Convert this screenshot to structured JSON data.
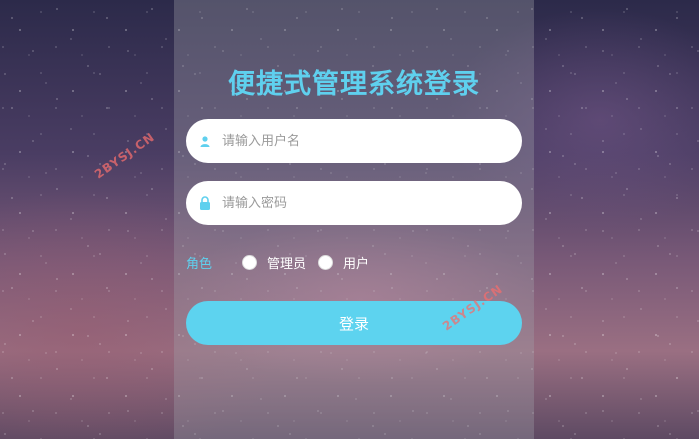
{
  "title": "便捷式管理系统登录",
  "username": {
    "placeholder": "请输入用户名",
    "icon": "user-icon"
  },
  "password": {
    "placeholder": "请输入密码",
    "icon": "lock-icon"
  },
  "role": {
    "label": "角色",
    "options": [
      "管理员",
      "用户"
    ]
  },
  "login_button": "登录",
  "watermark": "2BYSJ.CN",
  "colors": {
    "accent": "#5fd0ee",
    "button": "#5dd3ef",
    "field_bg": "#ffffff"
  }
}
